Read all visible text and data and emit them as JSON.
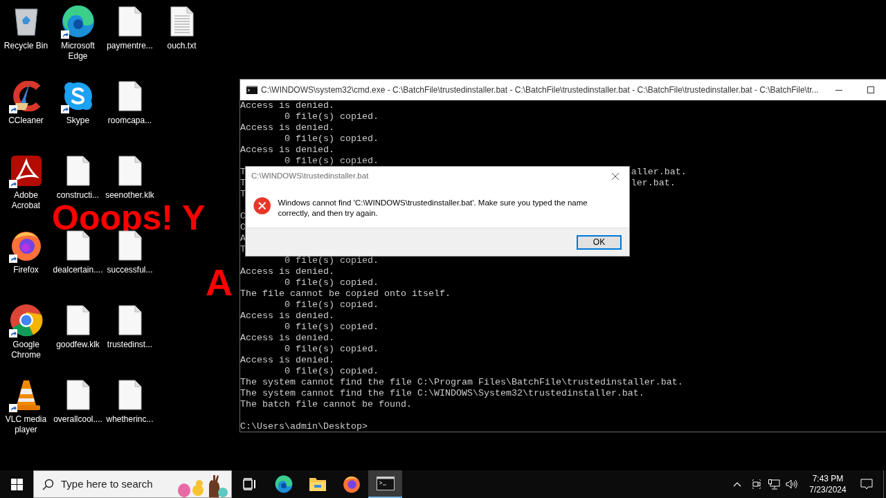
{
  "wallpaper_text": [
    "Ooops! Y",
    "A"
  ],
  "desktop_icons": [
    {
      "label": "Recycle Bin",
      "kind": "recycle",
      "shortcut": false
    },
    {
      "label": "CCleaner",
      "kind": "ccleaner",
      "shortcut": true
    },
    {
      "label": "Adobe Acrobat",
      "kind": "acrobat",
      "shortcut": true
    },
    {
      "label": "Firefox",
      "kind": "firefox",
      "shortcut": true
    },
    {
      "label": "Google Chrome",
      "kind": "chrome",
      "shortcut": true
    },
    {
      "label": "VLC media player",
      "kind": "vlc",
      "shortcut": true
    },
    {
      "label": "Microsoft Edge",
      "kind": "edge",
      "shortcut": true
    },
    {
      "label": "Skype",
      "kind": "skype",
      "shortcut": true
    },
    {
      "label": "constructi...",
      "kind": "file",
      "shortcut": false
    },
    {
      "label": "dealcertain....",
      "kind": "file",
      "shortcut": false
    },
    {
      "label": "goodfew.klk",
      "kind": "file",
      "shortcut": false
    },
    {
      "label": "overallcool....",
      "kind": "file",
      "shortcut": false
    },
    {
      "label": "paymentre...",
      "kind": "file",
      "shortcut": false
    },
    {
      "label": "roomcapa...",
      "kind": "file",
      "shortcut": false
    },
    {
      "label": "seenother.klk",
      "kind": "file",
      "shortcut": false
    },
    {
      "label": "successful...",
      "kind": "file",
      "shortcut": false
    },
    {
      "label": "trustedinst...",
      "kind": "file",
      "shortcut": false
    },
    {
      "label": "whetherinc...",
      "kind": "file",
      "shortcut": false
    },
    {
      "label": "ouch.txt",
      "kind": "text",
      "shortcut": false
    }
  ],
  "console_window": {
    "title": "C:\\WINDOWS\\system32\\cmd.exe - C:\\BatchFile\\trustedinstaller.bat - C:\\BatchFile\\trustedinstaller.bat - C:\\BatchFile\\trustedinstaller.bat - C:\\BatchFile\\tr...",
    "lines": [
      {
        "kind": "text",
        "text": "Access is denied."
      },
      {
        "kind": "text",
        "text": "        0 file(s) copied."
      },
      {
        "kind": "text",
        "text": "Access is denied."
      },
      {
        "kind": "text",
        "text": "        0 file(s) copied."
      },
      {
        "kind": "text",
        "text": "Access is denied."
      },
      {
        "kind": "text",
        "text": "        0 file(s) copied."
      },
      {
        "kind": "cut",
        "text": "T",
        "tail": "aller.bat."
      },
      {
        "kind": "cut",
        "text": "T",
        "tail": "ler.bat."
      },
      {
        "kind": "cut",
        "text": "T"
      },
      {
        "kind": "blank"
      },
      {
        "kind": "cut",
        "text": "C"
      },
      {
        "kind": "cut",
        "text": "C"
      },
      {
        "kind": "cut",
        "text": "A"
      },
      {
        "kind": "cut",
        "text": "T"
      },
      {
        "kind": "text",
        "text": "        0 file(s) copied."
      },
      {
        "kind": "text",
        "text": "Access is denied."
      },
      {
        "kind": "text",
        "text": "        0 file(s) copied."
      },
      {
        "kind": "text",
        "text": "The file cannot be copied onto itself."
      },
      {
        "kind": "text",
        "text": "        0 file(s) copied."
      },
      {
        "kind": "text",
        "text": "Access is denied."
      },
      {
        "kind": "text",
        "text": "        0 file(s) copied."
      },
      {
        "kind": "text",
        "text": "Access is denied."
      },
      {
        "kind": "text",
        "text": "        0 file(s) copied."
      },
      {
        "kind": "text",
        "text": "Access is denied."
      },
      {
        "kind": "text",
        "text": "        0 file(s) copied."
      },
      {
        "kind": "text",
        "text": "The system cannot find the file C:\\Program Files\\BatchFile\\trustedinstaller.bat."
      },
      {
        "kind": "text",
        "text": "The system cannot find the file C:\\WINDOWS\\System32\\trustedinstaller.bat."
      },
      {
        "kind": "text",
        "text": "The batch file cannot be found."
      },
      {
        "kind": "blank"
      },
      {
        "kind": "text",
        "text": "C:\\Users\\admin\\Desktop>"
      }
    ]
  },
  "dialog": {
    "title": "C:\\WINDOWS\\trustedinstaller.bat",
    "message": "Windows cannot find 'C:\\WINDOWS\\trustedinstaller.bat'. Make sure you typed the name correctly, and then try again.",
    "button": "OK"
  },
  "taskbar": {
    "search": {
      "placeholder": "Type here to search"
    },
    "apps": [
      {
        "kind": "taskview",
        "active": false
      },
      {
        "kind": "edge",
        "active": false
      },
      {
        "kind": "explorer",
        "active": false
      },
      {
        "kind": "firefox",
        "active": false
      },
      {
        "kind": "cmd",
        "active": true
      }
    ],
    "clock": {
      "time": "7:43 PM",
      "date": "7/23/2024"
    }
  }
}
